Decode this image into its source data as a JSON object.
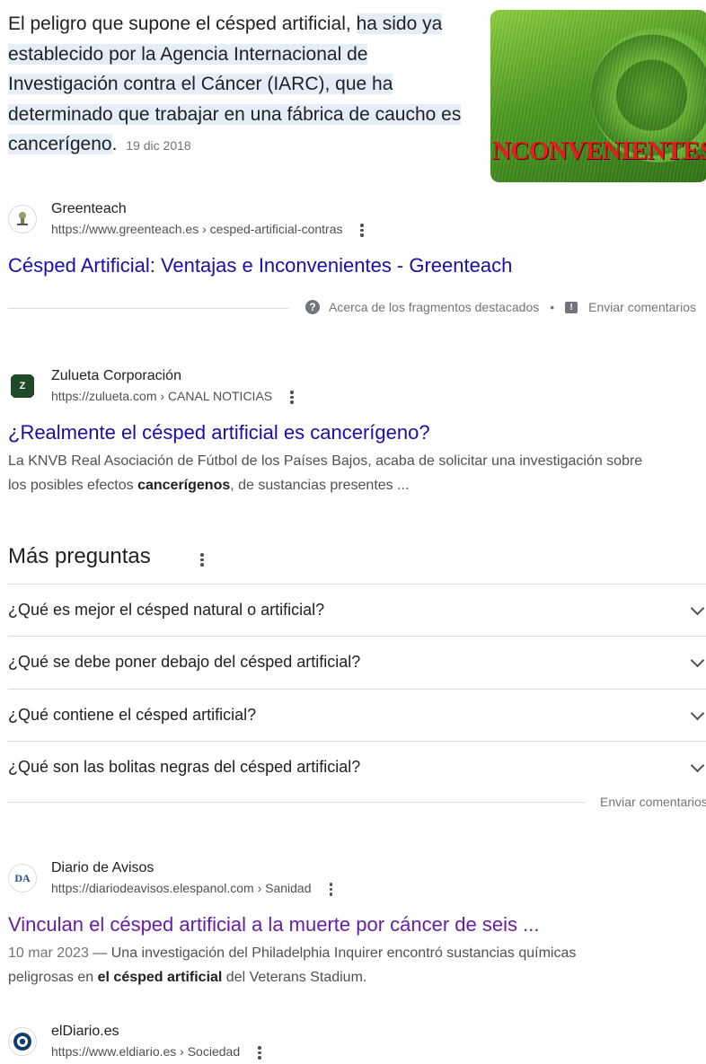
{
  "snippet": {
    "text_plain": "El peligro que supone el césped artificial, ",
    "text_highlight": "ha sido ya establecido por la Agencia Internacional de Investigación contra el Cáncer (IARC), que ha determinado que trabajar en una fábrica de caucho es cancerígeno",
    "text_end": ".",
    "date": "19 dic 2018",
    "image_text": "NCONVENIENTES"
  },
  "results": [
    {
      "site_name": "Greenteach",
      "url": "https://www.greenteach.es › cesped-artificial-contras",
      "title": "Césped Artificial: Ventajas e Inconvenientes - Greenteach"
    },
    {
      "site_name": "Zulueta Corporación",
      "url": "https://zulueta.com › CANAL NOTICIAS",
      "title": "¿Realmente el césped artificial es cancerígeno?",
      "desc_1": "La KNVB Real Asociación de Fútbol de los Países Bajos, acaba de solicitar una investigación sobre los posibles efectos ",
      "desc_bold": "cancerígenos",
      "desc_2": ", de sustancias presentes ..."
    },
    {
      "site_name": "Diario de Avisos",
      "url": "https://diariodeavisos.elespanol.com › Sanidad",
      "title": "Vinculan el césped artificial a la muerte por cáncer de seis ...",
      "date": "10 mar 2023",
      "desc_1": " — Una investigación del Philadelphia Inquirer encontró sustancias químicas peligrosas en ",
      "desc_bold": "el césped artificial",
      "desc_2": " del Veterans Stadium."
    },
    {
      "site_name": "elDiario.es",
      "url": "https://www.eldiario.es › Sociedad"
    }
  ],
  "about_bar": {
    "about_label": "Acerca de los fragmentos destacados",
    "separator": "•",
    "feedback_label": "Enviar comentarios"
  },
  "more_questions": {
    "title": "Más preguntas",
    "questions": [
      "¿Qué es mejor el césped natural o artificial?",
      "¿Qué se debe poner debajo del césped artificial?",
      "¿Qué contiene el césped artificial?",
      "¿Qué son las bolitas negras del césped artificial?"
    ],
    "feedback_label": "Enviar comentarios"
  },
  "favicons": {
    "zulueta_letter": "Z",
    "diario_letters": "DA"
  },
  "colors": {
    "link": "#1a0dab",
    "visited": "#681da8",
    "highlight": "#e5edf9"
  }
}
